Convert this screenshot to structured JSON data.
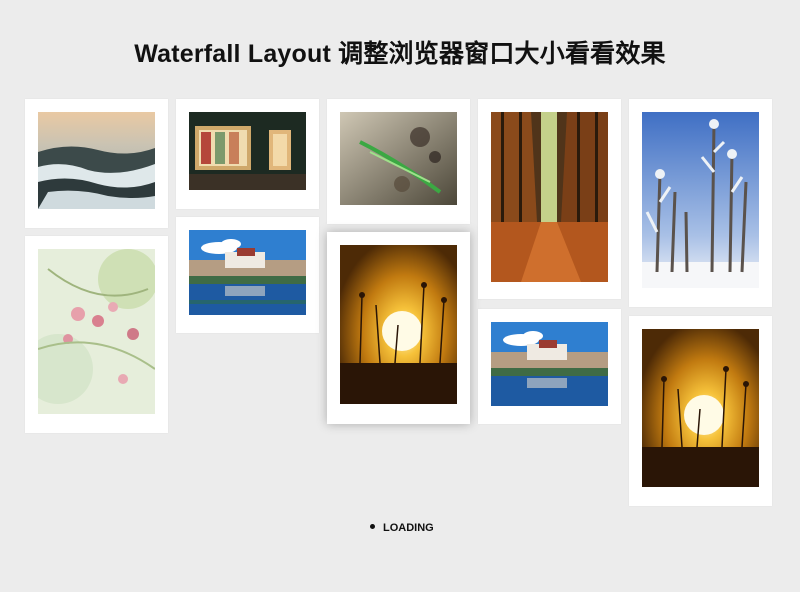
{
  "page": {
    "title": "Waterfall Layout 调整浏览器窗口大小看看效果"
  },
  "status": {
    "loading_text": "LOADING"
  },
  "images": [
    {
      "subject": "snowy-winter-field"
    },
    {
      "subject": "lit-shop-window-at-night"
    },
    {
      "subject": "abstract-green-leaf-art"
    },
    {
      "subject": "autumn-forest-path"
    },
    {
      "subject": "frosted-trees-blue-sky"
    },
    {
      "subject": "pink-blossoms-soft-focus"
    },
    {
      "subject": "potala-palace-lake-reflection"
    },
    {
      "subject": "sunset-with-grass-silhouette"
    },
    {
      "subject": "potala-palace-lake-reflection"
    },
    {
      "subject": "sunset-with-grass-silhouette"
    }
  ]
}
